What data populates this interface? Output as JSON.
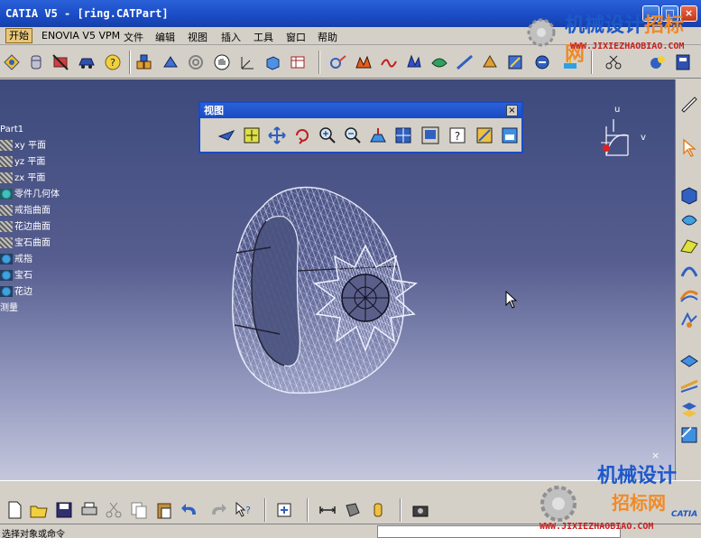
{
  "window": {
    "title": "CATIA V5 - [ring.CATPart]",
    "min_label": "_",
    "max_label": "□",
    "close_label": "×"
  },
  "menu": {
    "items": [
      "开始",
      "ENOVIA V5 VPM",
      "文件",
      "编辑",
      "视图",
      "插入",
      "工具",
      "窗口",
      "帮助"
    ]
  },
  "tree": {
    "nodes": [
      "Part1",
      "xy 平面",
      "yz 平面",
      "zx 平面",
      "零件几何体",
      "戒指曲面",
      "花边曲面",
      "宝石曲面",
      "戒指",
      "宝石",
      "花边",
      "测量"
    ]
  },
  "view_toolbar": {
    "title": "视图",
    "close_label": "×"
  },
  "compass": {
    "u_label": "u",
    "v_label": "v"
  },
  "statusbar": {
    "text": "选择对象或命令",
    "command_value": ""
  },
  "watermark": {
    "top_text_blue": "机械设计",
    "top_text_orange": "招标网",
    "top_url": "WWW.JIXIEZHAOBIAO.COM",
    "bottom_text_blue": "机械设计",
    "bottom_text_orange": "招标网",
    "bottom_url": "WWW.JIXIEZHAOBIAO.COM",
    "catia_label": "CATIA"
  },
  "colors": {
    "titlebar": "#1a4bc4",
    "viewport_top": "#3d4a7c",
    "viewport_bottom": "#c4c7dc",
    "watermark_blue": "#1e58c8",
    "watermark_orange": "#f08a28",
    "watermark_url": "#c81e1e"
  }
}
